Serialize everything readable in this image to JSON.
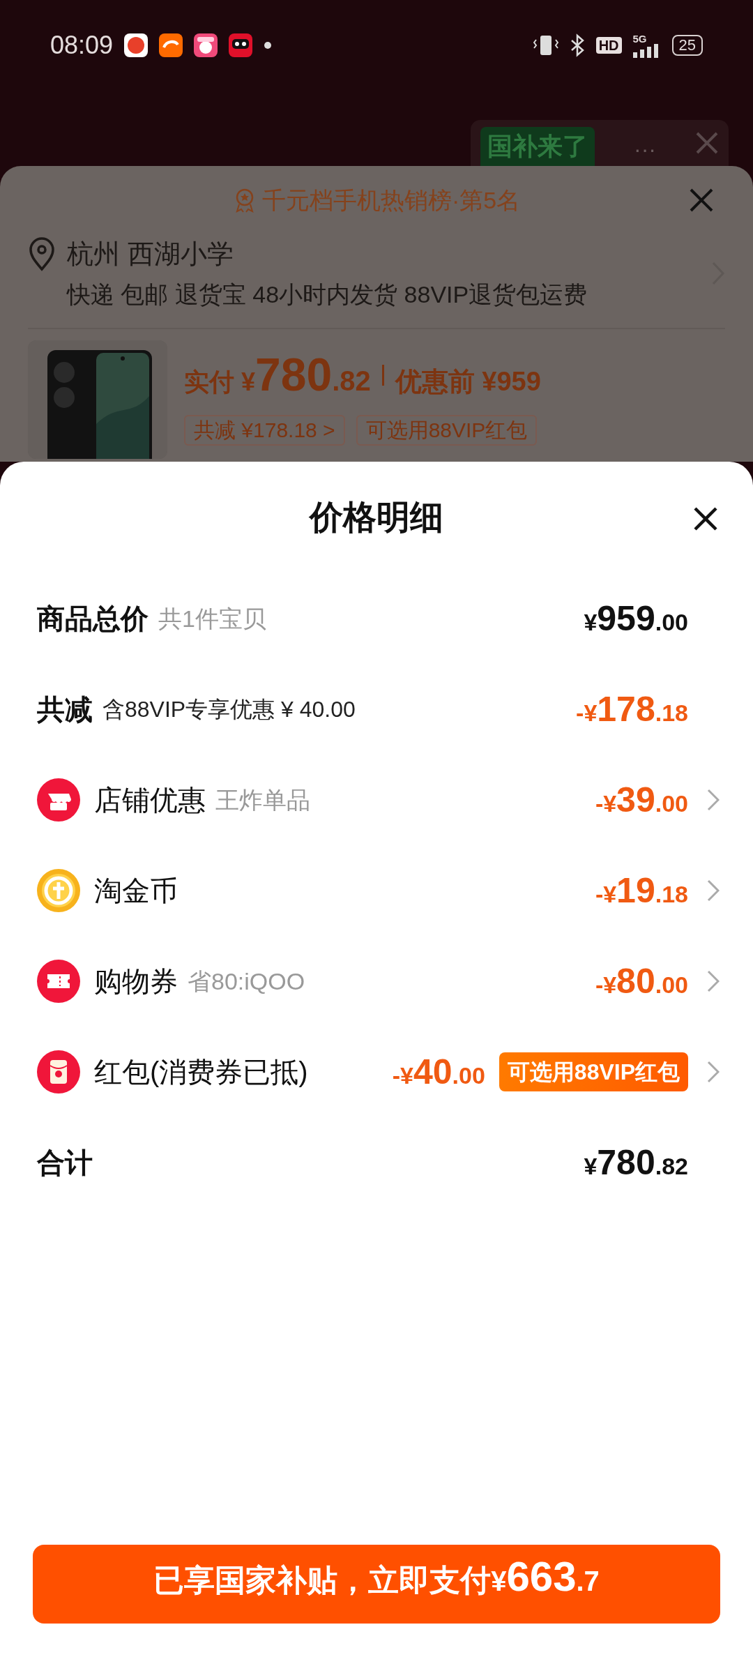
{
  "status_bar": {
    "time": "08:09",
    "hd": "HD",
    "network": "5G",
    "battery": "25"
  },
  "background": {
    "banner": "国补来了",
    "more": "···",
    "ranking": "千元档手机热销榜·第5名",
    "address": "杭州 西湖小学",
    "services": "快递 包邮 退货宝 48小时内发货 88VIP退货包运费",
    "price": {
      "label": "实付",
      "currency": "¥",
      "integer": "780",
      "decimal": ".82"
    },
    "original_price": {
      "label": "优惠前",
      "value": "¥959"
    },
    "tags": [
      "共减 ¥178.18 >",
      "可选用88VIP红包"
    ]
  },
  "price_detail": {
    "title": "价格明细",
    "rows": [
      {
        "kind": "summary",
        "label": "商品总价",
        "note": "共1件宝贝",
        "amount": {
          "prefix": "¥",
          "integer": "959",
          "decimal": ".00"
        }
      },
      {
        "kind": "discount",
        "label": "共减",
        "note": "含88VIP专享优惠 ¥ 40.00",
        "amount": {
          "prefix": "-¥",
          "integer": "178",
          "decimal": ".18"
        }
      },
      {
        "kind": "item",
        "label": "店铺优惠",
        "note": "王炸单品",
        "amount": {
          "prefix": "-¥",
          "integer": "39",
          "decimal": ".00"
        }
      },
      {
        "kind": "item",
        "label": "淘金币",
        "amount": {
          "prefix": "-¥",
          "integer": "19",
          "decimal": ".18"
        }
      },
      {
        "kind": "item",
        "label": "购物券",
        "note": "省80:iQOO",
        "amount": {
          "prefix": "-¥",
          "integer": "80",
          "decimal": ".00"
        }
      },
      {
        "kind": "item",
        "label": "红包(消费券已抵)",
        "amount": {
          "prefix": "-¥",
          "integer": "40",
          "decimal": ".00"
        },
        "badge": "可选用88VIP红包"
      },
      {
        "kind": "total",
        "label": "合计",
        "amount": {
          "prefix": "¥",
          "integer": "780",
          "decimal": ".82"
        }
      }
    ]
  },
  "pay_button": {
    "label": "已享国家补贴，立即支付",
    "currency": "¥",
    "integer": "663",
    "decimal": ".7"
  }
}
